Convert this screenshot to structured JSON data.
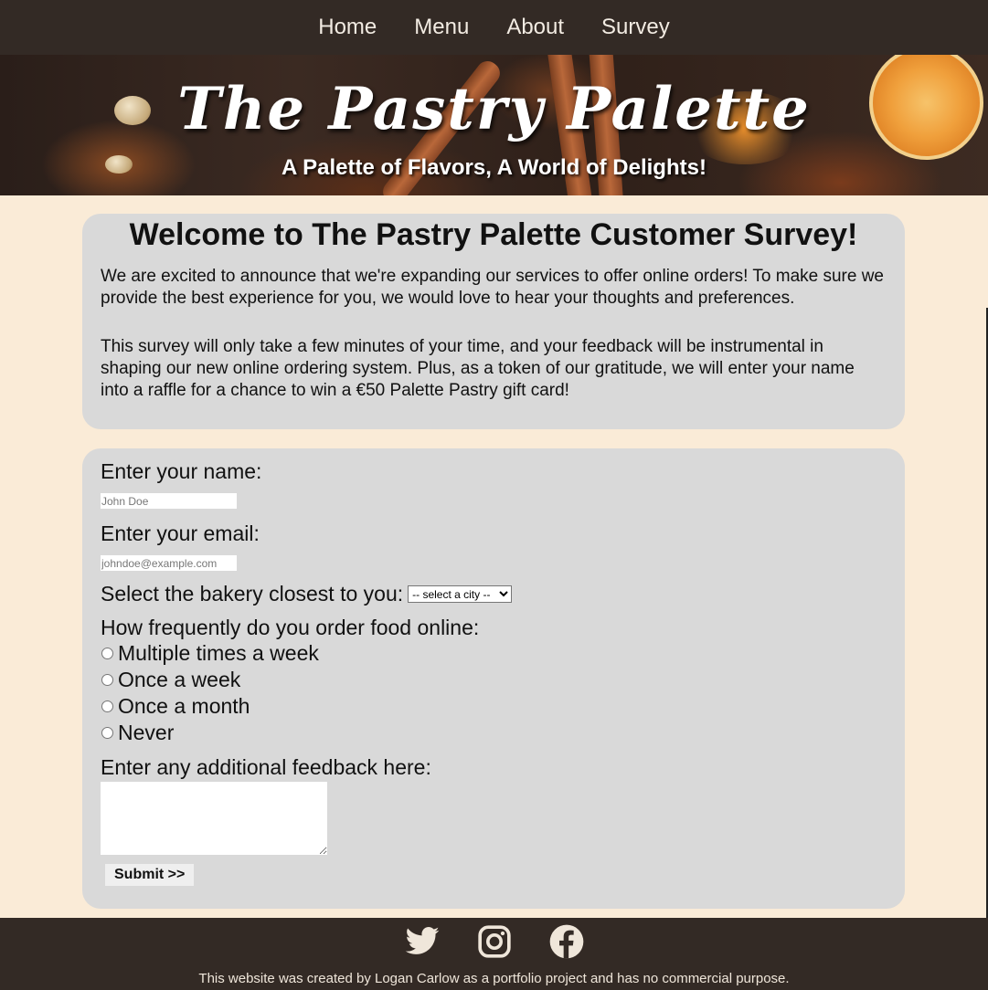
{
  "nav": {
    "items": [
      "Home",
      "Menu",
      "About",
      "Survey"
    ]
  },
  "hero": {
    "title": "The Pastry Palette",
    "subtitle": "A Palette of Flavors, A World of Delights!"
  },
  "intro": {
    "heading": "Welcome to The Pastry Palette Customer Survey!",
    "paragraph1": "We are excited to announce that we're expanding our services to offer online orders! To make sure we provide the best experience for you, we would love to hear your thoughts and preferences.",
    "paragraph2": "This survey will only take a few minutes of your time, and your feedback will be instrumental in shaping our new online ordering system. Plus, as a token of our gratitude, we will enter your name into a raffle for a chance to win a €50 Palette Pastry gift card!"
  },
  "form": {
    "name_label": "Enter your name:",
    "name_placeholder": "John Doe",
    "email_label": "Enter your email:",
    "email_placeholder": "johndoe@example.com",
    "bakery_label": "Select the bakery closest to you:",
    "bakery_selected": "-- select a city --",
    "frequency_label": "How frequently do you order food online:",
    "frequency_options": [
      "Multiple times a week",
      "Once a week",
      "Once a month",
      "Never"
    ],
    "feedback_label": "Enter any additional feedback here:",
    "submit_label": "Submit >>"
  },
  "footer": {
    "socials": [
      "twitter-icon",
      "instagram-icon",
      "facebook-icon"
    ],
    "credit": "This website was created by Logan Carlow as a portfolio project and has no commercial purpose."
  },
  "colors": {
    "nav_bg": "#332a25",
    "page_bg": "#faebd7",
    "card_bg": "#d9d9d9"
  }
}
